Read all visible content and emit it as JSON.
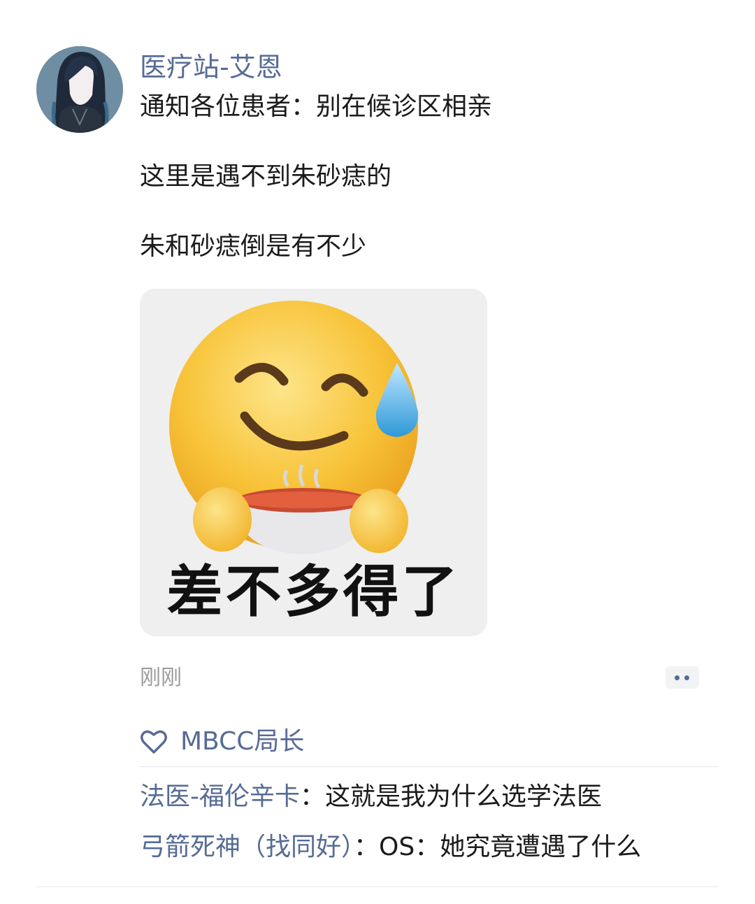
{
  "post": {
    "author": "医疗站-艾恩",
    "lines": [
      "通知各位患者：别在候诊区相亲",
      "这里是遇不到朱砂痣的",
      "朱和砂痣倒是有不少"
    ],
    "sticker_caption": "差不多得了",
    "time": "刚刚"
  },
  "likes": {
    "icon": "heart-icon",
    "names": "MBCC局长"
  },
  "comments": [
    {
      "author": "法医-福伦辛卡",
      "separator": "：",
      "text": "这就是我为什么选学法医"
    },
    {
      "author": "弓箭死神（找同好）",
      "separator": "：",
      "text": "OS：她究竟遭遇了什么"
    }
  ],
  "colors": {
    "link": "#576b95",
    "text": "#1b1b1b",
    "muted": "#9b9b9b"
  }
}
